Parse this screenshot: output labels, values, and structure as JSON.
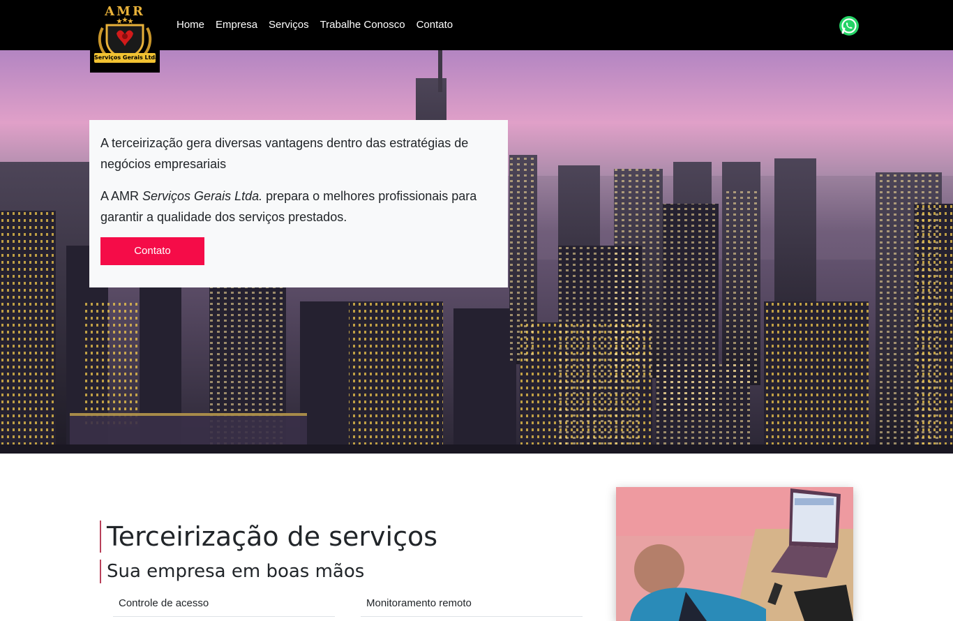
{
  "brand": {
    "logo_text": "AMR",
    "ribbon_text": "Serviços Gerais Ltda"
  },
  "nav": {
    "items": [
      "Home",
      "Empresa",
      "Serviços",
      "Trabalhe Conosco",
      "Contato"
    ]
  },
  "hero": {
    "paragraph1": "A terceirização gera diversas vantagens dentro das estratégias de negócios empresariais",
    "paragraph2_prefix": "A AMR ",
    "paragraph2_italic": "Serviços Gerais Ltda.",
    "paragraph2_suffix": " prepara o melhores profissionais para garantir a qualidade dos serviços prestados.",
    "button_label": "Contato"
  },
  "section": {
    "title": "Terceirização de serviços",
    "subtitle": "Sua empresa em boas mãos",
    "services": [
      "Controle de acesso",
      "Monitoramento remoto"
    ]
  },
  "colors": {
    "navbar": "#000000",
    "accent": "#f50c48",
    "logo_gold": "#e9b23a",
    "border_accent": "#b8415a",
    "card_bg": "#f8f9fa",
    "whatsapp_green": "#25d366"
  },
  "icons": [
    "whatsapp-icon",
    "phoenix-shield-icon"
  ]
}
